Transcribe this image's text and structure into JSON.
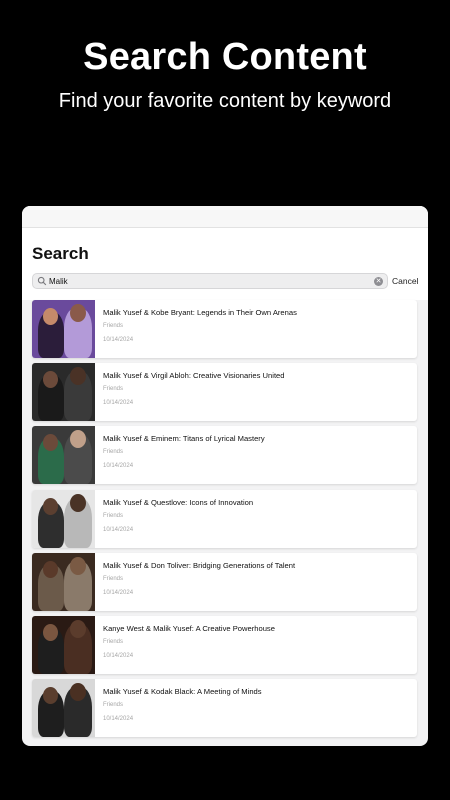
{
  "promo": {
    "title": "Search Content",
    "subtitle": "Find your favorite content by keyword"
  },
  "search": {
    "heading": "Search",
    "query": "Malik",
    "clear_icon": "clear-icon",
    "cancel_label": "Cancel"
  },
  "results": [
    {
      "title": "Malik Yusef & Kobe Bryant: Legends in Their Own Arenas",
      "category": "Friends",
      "date": "10/14/2024",
      "colors": [
        "#6a4a9c",
        "#2b1d3a",
        "#c58a6a",
        "#8a5a4a",
        "#b39ad8"
      ]
    },
    {
      "title": "Malik Yusef & Virgil Abloh: Creative Visionaries United",
      "category": "Friends",
      "date": "10/14/2024",
      "colors": [
        "#2a2a2a",
        "#1a1a1a",
        "#6b4a3a",
        "#4a3226",
        "#3a3a3a"
      ]
    },
    {
      "title": "Malik Yusef & Eminem: Titans of Lyrical Mastery",
      "category": "Friends",
      "date": "10/14/2024",
      "colors": [
        "#3a3a3a",
        "#2b6b4a",
        "#6b4a3a",
        "#c0a08a",
        "#4b4b4b"
      ]
    },
    {
      "title": "Malik Yusef & Questlove: Icons of Innovation",
      "category": "Friends",
      "date": "10/14/2024",
      "colors": [
        "#e6e6e6",
        "#2e2e2e",
        "#5b3f30",
        "#4a3326",
        "#b8b8b8"
      ]
    },
    {
      "title": "Malik Yusef & Don Toliver: Bridging Generations of Talent",
      "category": "Friends",
      "date": "10/14/2024",
      "colors": [
        "#3a2a20",
        "#6b5a4a",
        "#5a3a2a",
        "#7a5a44",
        "#8a7a6a"
      ]
    },
    {
      "title": "Kanye West & Malik Yusef: A Creative Powerhouse",
      "category": "Friends",
      "date": "10/14/2024",
      "colors": [
        "#2a1a14",
        "#1e1e1e",
        "#7a5640",
        "#5b3c2c",
        "#4a2e22"
      ]
    },
    {
      "title": "Malik Yusef & Kodak Black: A Meeting of Minds",
      "category": "Friends",
      "date": "10/14/2024",
      "colors": [
        "#d8d8d8",
        "#1e1e1e",
        "#5a3e2e",
        "#4a3022",
        "#2a2a2a"
      ]
    }
  ]
}
